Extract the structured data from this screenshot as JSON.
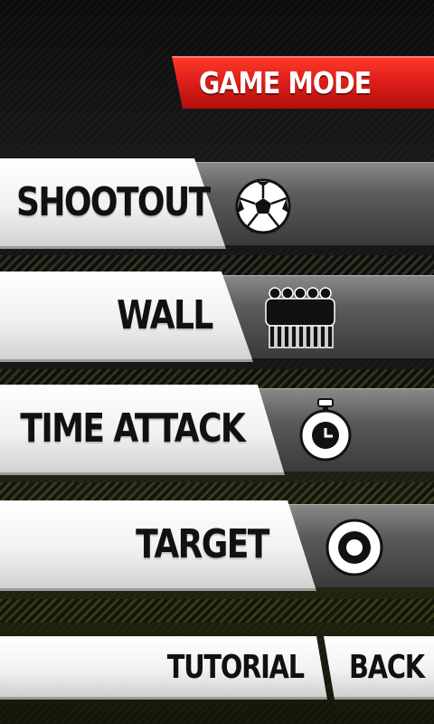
{
  "header": {
    "title": "GAME MODE"
  },
  "modes": [
    {
      "label": "SHOOTOUT",
      "icon": "soccer-ball-icon"
    },
    {
      "label": "WALL",
      "icon": "player-wall-icon"
    },
    {
      "label": "TIME ATTACK",
      "icon": "stopwatch-icon"
    },
    {
      "label": "TARGET",
      "icon": "target-icon"
    }
  ],
  "footer": {
    "tutorial": "TUTORIAL",
    "back": "BACK"
  },
  "colors": {
    "banner_red": "#e0201a",
    "text_dark": "#111111",
    "panel_white": "#f1f1f1",
    "panel_dark": "#4a4a4a"
  }
}
